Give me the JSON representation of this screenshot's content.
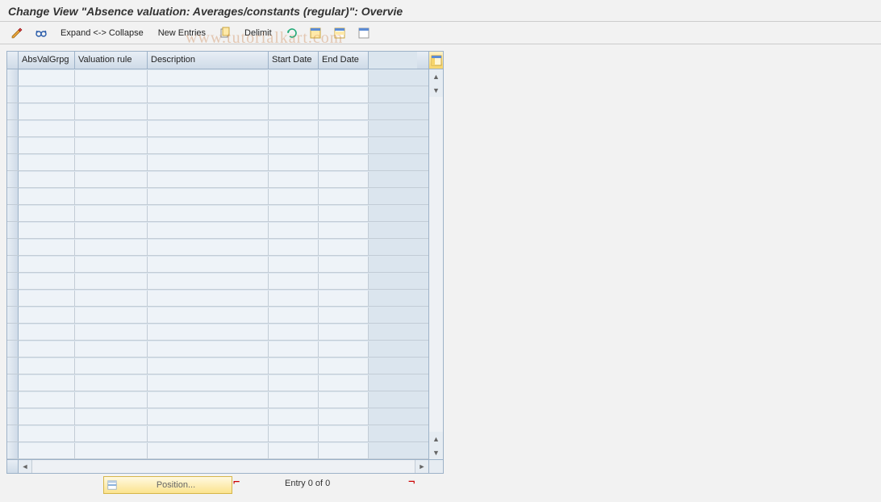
{
  "title": "Change View \"Absence valuation: Averages/constants (regular)\": Overvie",
  "toolbar": {
    "expand_collapse": "Expand <-> Collapse",
    "new_entries": "New Entries",
    "delimit": "Delimit"
  },
  "icons": {
    "pencil_glasses": "change-display-toggle-icon",
    "glasses": "other-view-icon",
    "copy": "copy-icon",
    "undo": "undo-icon",
    "select_all": "select-all-icon",
    "select_block": "select-block-icon",
    "deselect": "deselect-all-icon",
    "config": "table-settings-icon",
    "position": "position-icon"
  },
  "grid": {
    "columns": [
      "AbsValGrpg",
      "Valuation rule",
      "Description",
      "Start Date",
      "End Date"
    ],
    "row_count": 23
  },
  "footer": {
    "position_label": "Position...",
    "entry_text": "Entry 0 of 0"
  },
  "watermark": "www.tutorialkart.com"
}
